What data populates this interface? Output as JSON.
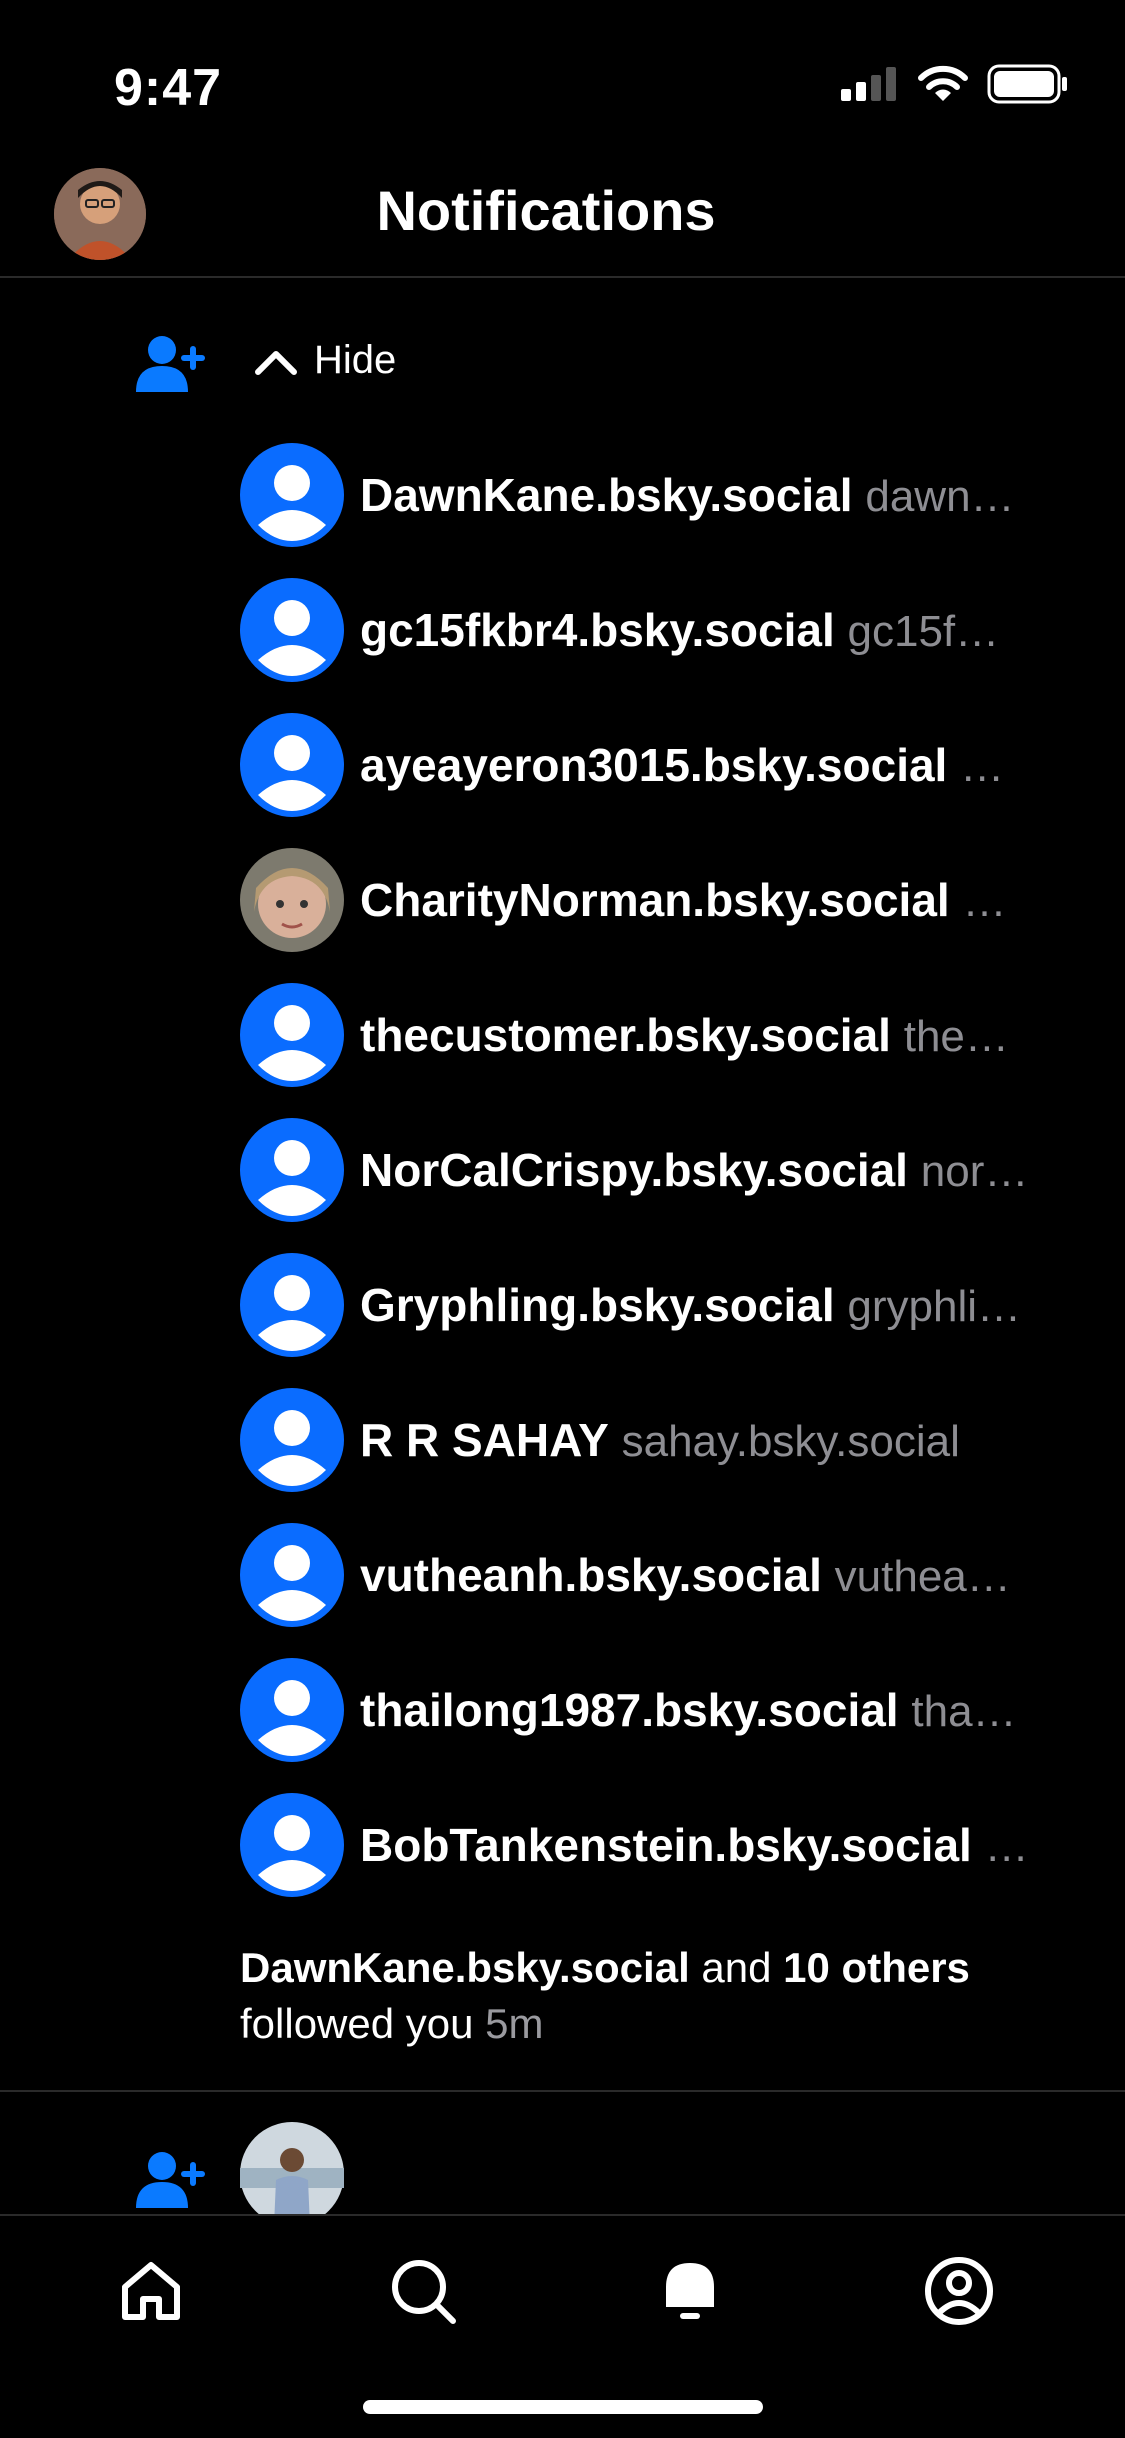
{
  "status_bar": {
    "time": "9:47"
  },
  "header": {
    "title": "Notifications"
  },
  "group": {
    "hide_label": "Hide"
  },
  "followers": [
    {
      "name": "DawnKane.bsky.social",
      "handle": "dawn…",
      "avatar": "default"
    },
    {
      "name": "gc15fkbr4.bsky.social",
      "handle": "gc15f…",
      "avatar": "default"
    },
    {
      "name": "ayeayeron3015.bsky.social",
      "handle": "…",
      "avatar": "default"
    },
    {
      "name": "CharityNorman.bsky.social",
      "handle": "…",
      "avatar": "photo"
    },
    {
      "name": "thecustomer.bsky.social",
      "handle": "the…",
      "avatar": "default"
    },
    {
      "name": "NorCalCrispy.bsky.social",
      "handle": "nor…",
      "avatar": "default"
    },
    {
      "name": "Gryphling.bsky.social",
      "handle": "gryphli…",
      "avatar": "default"
    },
    {
      "name": "R R SAHAY",
      "handle": "sahay.bsky.social",
      "avatar": "default"
    },
    {
      "name": "vutheanh.bsky.social",
      "handle": "vuthea…",
      "avatar": "default"
    },
    {
      "name": "thailong1987.bsky.social",
      "handle": "tha…",
      "avatar": "default"
    },
    {
      "name": "BobTankenstein.bsky.social",
      "handle": "…",
      "avatar": "default"
    }
  ],
  "summary": {
    "name": "DawnKane.bsky.social",
    "and": "and",
    "others": "10 others",
    "action": "followed you",
    "time": "5m"
  },
  "colors": {
    "accent": "#0a7aff",
    "background": "#000000",
    "muted": "#8e8e93"
  },
  "tabs": [
    {
      "name": "home-icon"
    },
    {
      "name": "search-icon"
    },
    {
      "name": "notifications-icon"
    },
    {
      "name": "profile-icon"
    }
  ]
}
